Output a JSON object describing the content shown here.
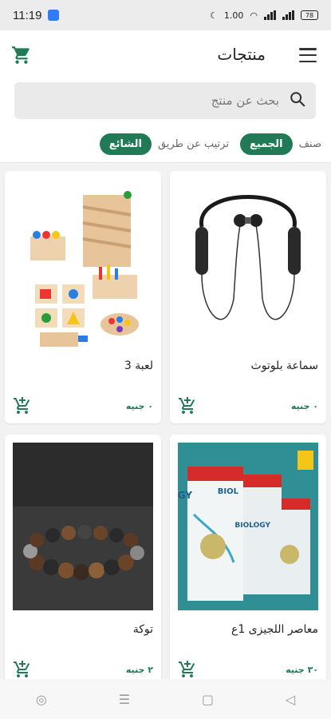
{
  "status_bar": {
    "time": "11:19",
    "data_speed": "1.00",
    "battery": "78"
  },
  "app_bar": {
    "title": "منتجات"
  },
  "search": {
    "placeholder": "بحث عن منتج"
  },
  "filters": {
    "category_label": "صنف",
    "all_chip": "الجميع",
    "sort_label": "ترتيب عن طريق",
    "popular_chip": "الشائع"
  },
  "products": [
    {
      "name": "سماعة بلوتوث",
      "price": "٠ جنيه",
      "image": "neckband-headphones"
    },
    {
      "name": "لعبة 3",
      "price": "٠ جنيه",
      "image": "wooden-montessori-toys"
    },
    {
      "name": "معاصر اللجيزى 1ع",
      "price": "٣٠ جنيه",
      "image": "biology-books"
    },
    {
      "name": "توكة",
      "price": "٢ جنيه",
      "image": "beaded-bracelet"
    }
  ],
  "colors": {
    "accent": "#1f7a55"
  },
  "icons": [
    "menu-icon",
    "cart-icon",
    "search-icon",
    "add-to-cart-icon"
  ]
}
